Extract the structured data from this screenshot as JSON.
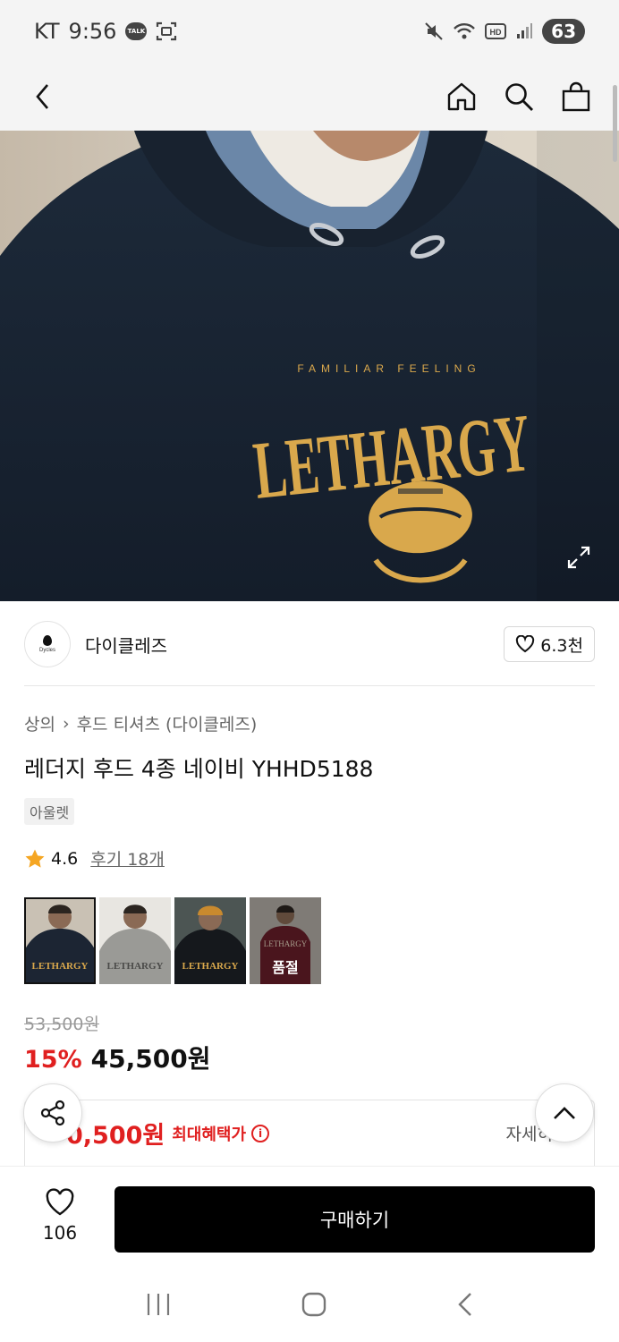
{
  "status": {
    "carrier": "KT",
    "time": "9:56",
    "talk": "TALK",
    "battery": "63"
  },
  "seller": {
    "name": "다이클레즈",
    "logo_text": "Dycles",
    "likes": "6.3천"
  },
  "hero": {
    "print_small": "FAMILIAR FEELING",
    "print_big": "LETHARGY"
  },
  "breadcrumb": {
    "category": "상의",
    "separator": "›",
    "subcategory": "후드 티셔츠 (다이클레즈)"
  },
  "product": {
    "title": "레더지 후드 4종 네이비 YHHD5188",
    "tag": "아울렛",
    "rating": "4.6",
    "review_label": "후기 18개"
  },
  "thumbnails": [
    {
      "label": "",
      "colors": {
        "bg": "#c9c1b4",
        "shirt": "#1c2533"
      }
    },
    {
      "label": "",
      "colors": {
        "bg": "#e8e6e1",
        "shirt": "#9a9a96"
      }
    },
    {
      "label": "",
      "colors": {
        "bg": "#4c5553",
        "shirt": "#15181c"
      }
    },
    {
      "label": "품절",
      "colors": {
        "bg": "#b6b0aa",
        "shirt": "#6b1f2a"
      }
    }
  ],
  "price": {
    "original": "53,500원",
    "discount": "15%",
    "sale": "45,500원",
    "benefit_price": "0,500원",
    "benefit_label": "최대혜택가",
    "detail_label": "자세히"
  },
  "bottom": {
    "wish_count": "106",
    "buy_label": "구매하기"
  },
  "colors": {
    "accent": "#e02020",
    "primary": "#000000",
    "star": "#f5a623"
  }
}
